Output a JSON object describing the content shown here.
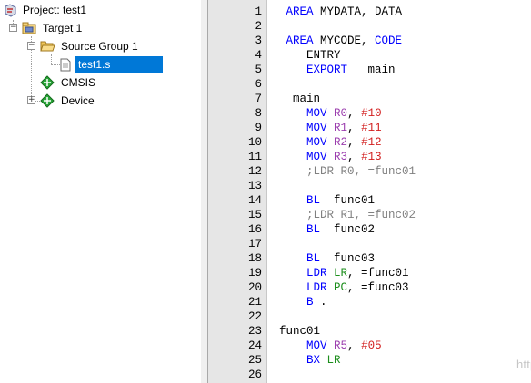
{
  "project": {
    "root": "Project: test1",
    "target": "Target 1",
    "group": "Source Group 1",
    "file": "test1.s",
    "cmsis": "CMSIS",
    "device": "Device"
  },
  "editor": {
    "lines": [
      {
        "n": "1",
        "t": [
          {
            "c": "blue",
            "s": " AREA"
          },
          {
            "c": "plain",
            "s": " MYDATA, DATA"
          }
        ]
      },
      {
        "n": "2",
        "t": []
      },
      {
        "n": "3",
        "t": [
          {
            "c": "blue",
            "s": " AREA"
          },
          {
            "c": "plain",
            "s": " MYCODE, "
          },
          {
            "c": "blue",
            "s": "CODE"
          }
        ]
      },
      {
        "n": "4",
        "t": [
          {
            "c": "plain",
            "s": "    ENTRY"
          }
        ]
      },
      {
        "n": "5",
        "t": [
          {
            "c": "blue",
            "s": "    EXPORT"
          },
          {
            "c": "plain",
            "s": " __main"
          }
        ]
      },
      {
        "n": "6",
        "t": []
      },
      {
        "n": "7",
        "t": [
          {
            "c": "plain",
            "s": "__main"
          }
        ]
      },
      {
        "n": "8",
        "t": [
          {
            "c": "blue",
            "s": "    MOV"
          },
          {
            "c": "plain",
            "s": " "
          },
          {
            "c": "reg",
            "s": "R0"
          },
          {
            "c": "plain",
            "s": ", "
          },
          {
            "c": "num",
            "s": "#10"
          }
        ]
      },
      {
        "n": "9",
        "t": [
          {
            "c": "blue",
            "s": "    MOV"
          },
          {
            "c": "plain",
            "s": " "
          },
          {
            "c": "reg",
            "s": "R1"
          },
          {
            "c": "plain",
            "s": ", "
          },
          {
            "c": "num",
            "s": "#11"
          }
        ]
      },
      {
        "n": "10",
        "t": [
          {
            "c": "blue",
            "s": "    MOV"
          },
          {
            "c": "plain",
            "s": " "
          },
          {
            "c": "reg",
            "s": "R2"
          },
          {
            "c": "plain",
            "s": ", "
          },
          {
            "c": "num",
            "s": "#12"
          }
        ]
      },
      {
        "n": "11",
        "t": [
          {
            "c": "blue",
            "s": "    MOV"
          },
          {
            "c": "plain",
            "s": " "
          },
          {
            "c": "reg",
            "s": "R3"
          },
          {
            "c": "plain",
            "s": ", "
          },
          {
            "c": "num",
            "s": "#13"
          }
        ]
      },
      {
        "n": "12",
        "t": [
          {
            "c": "cmt",
            "s": "    ;LDR R0, =func01"
          }
        ]
      },
      {
        "n": "13",
        "t": []
      },
      {
        "n": "14",
        "t": [
          {
            "c": "blue",
            "s": "    BL"
          },
          {
            "c": "plain",
            "s": "  func01"
          }
        ]
      },
      {
        "n": "15",
        "t": [
          {
            "c": "cmt",
            "s": "    ;LDR R1, =func02"
          }
        ]
      },
      {
        "n": "16",
        "t": [
          {
            "c": "blue",
            "s": "    BL"
          },
          {
            "c": "plain",
            "s": "  func02"
          }
        ]
      },
      {
        "n": "17",
        "t": []
      },
      {
        "n": "18",
        "t": [
          {
            "c": "blue",
            "s": "    BL"
          },
          {
            "c": "plain",
            "s": "  func03"
          }
        ]
      },
      {
        "n": "19",
        "t": [
          {
            "c": "blue",
            "s": "    LDR"
          },
          {
            "c": "plain",
            "s": " "
          },
          {
            "c": "lab",
            "s": "LR"
          },
          {
            "c": "plain",
            "s": ", =func01"
          }
        ]
      },
      {
        "n": "20",
        "t": [
          {
            "c": "blue",
            "s": "    LDR"
          },
          {
            "c": "plain",
            "s": " "
          },
          {
            "c": "lab",
            "s": "PC"
          },
          {
            "c": "plain",
            "s": ", =func03"
          }
        ]
      },
      {
        "n": "21",
        "t": [
          {
            "c": "blue",
            "s": "    B"
          },
          {
            "c": "plain",
            "s": " ."
          }
        ]
      },
      {
        "n": "22",
        "t": []
      },
      {
        "n": "23",
        "t": [
          {
            "c": "plain",
            "s": "func01"
          }
        ]
      },
      {
        "n": "24",
        "t": [
          {
            "c": "blue",
            "s": "    MOV"
          },
          {
            "c": "plain",
            "s": " "
          },
          {
            "c": "reg",
            "s": "R5"
          },
          {
            "c": "plain",
            "s": ", "
          },
          {
            "c": "num",
            "s": "#05"
          }
        ]
      },
      {
        "n": "25",
        "t": [
          {
            "c": "blue",
            "s": "    BX"
          },
          {
            "c": "plain",
            "s": " "
          },
          {
            "c": "lab",
            "s": "LR"
          }
        ]
      },
      {
        "n": "26",
        "t": []
      }
    ]
  },
  "watermark": "https://blog.csdn.net/rude_dragon",
  "colors": {
    "keyword": "#0000ff",
    "register": "#9b3dae",
    "number": "#d21f1f",
    "link_register": "#1c8e1c",
    "comment": "#808080",
    "selection": "#0078d7",
    "gutter": "#e6e6e6"
  },
  "icons": {
    "project": "project-icon",
    "target": "target-icon",
    "group": "folder-open-icon",
    "file": "file-icon",
    "cmsis": "component-icon",
    "device": "component-icon"
  }
}
